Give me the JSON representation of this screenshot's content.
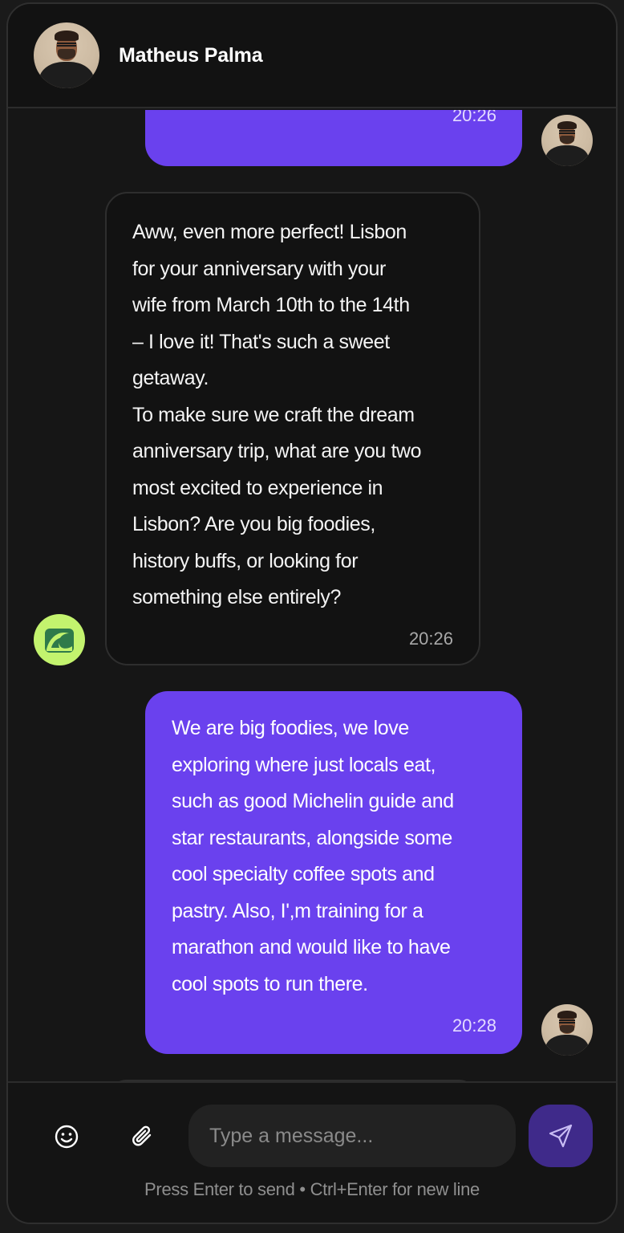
{
  "contact": {
    "name": "Matheus Palma"
  },
  "messages": [
    {
      "sender": "user",
      "text": "",
      "time": "20:26"
    },
    {
      "sender": "assistant",
      "text": "Aww, even more perfect! Lisbon\nfor your anniversary with your\nwife from March 10th to the 14th\n– I love it! That's such a sweet\ngetaway.\nTo make sure we craft the dream\nanniversary trip, what are you two\nmost excited to experience in\nLisbon? Are you big foodies,\nhistory buffs, or looking for\nsomething else entirely?",
      "time": "20:26"
    },
    {
      "sender": "user",
      "text": "We are big foodies, we love\nexploring where just locals eat,\nsuch as good Michelin guide and\nstar restaurants, alongside some\ncool specialty coffee spots and\npastry. Also, I',m training for a\nmarathon and would like to have\ncool spots to run there.",
      "time": "20:28"
    }
  ],
  "composer": {
    "placeholder": "Type a message...",
    "value": "",
    "hint": "Press Enter to send • Ctrl+Enter for new line",
    "icons": [
      "emoji-icon",
      "paperclip-icon",
      "send-icon"
    ]
  },
  "colors": {
    "background": "#161616",
    "outgoing_bubble": "#6a41ee",
    "incoming_bubble": "#121212",
    "send_button": "#3f2a8a",
    "bot_avatar": "#c3f36e"
  }
}
